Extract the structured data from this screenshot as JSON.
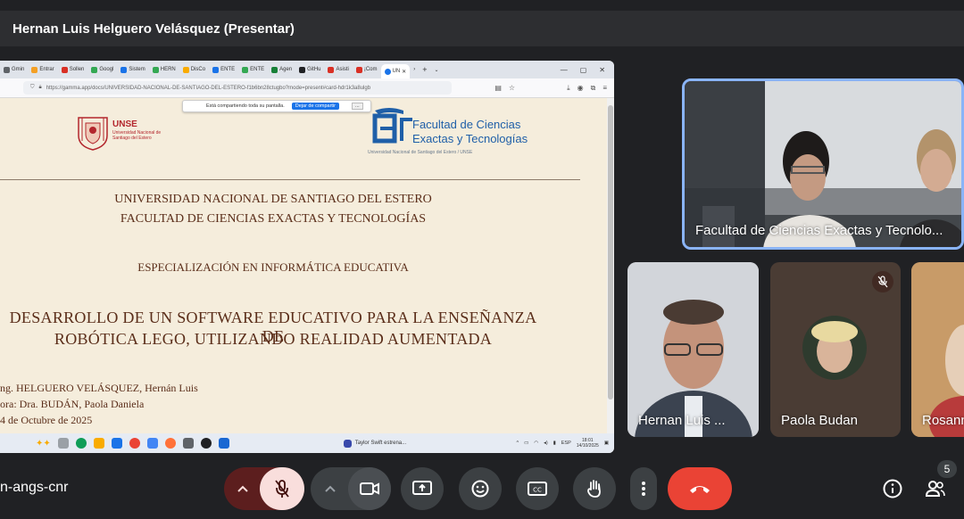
{
  "meeting": {
    "presenter_title": "Hernan Luis Helguero Velásquez (Presentar)",
    "meeting_code": "n-angs-cnr",
    "participant_count": "5"
  },
  "browser": {
    "tabs": [
      {
        "label": "Gmin",
        "color": "#5f6368"
      },
      {
        "label": "Entrar",
        "color": "#f4a025"
      },
      {
        "label": "Sollen",
        "color": "#d93025"
      },
      {
        "label": "Googl",
        "color": "#34a853"
      },
      {
        "label": "Sistem",
        "color": "#1a73e8"
      },
      {
        "label": "HERN",
        "color": "#34a853"
      },
      {
        "label": "DisCo",
        "color": "#f9ab00"
      },
      {
        "label": "ENTE",
        "color": "#1a73e8"
      },
      {
        "label": "ENTE",
        "color": "#34a853"
      },
      {
        "label": "Agen",
        "color": "#188038"
      },
      {
        "label": "GitHu",
        "color": "#202124"
      },
      {
        "label": "Asisti",
        "color": "#d93025"
      },
      {
        "label": "¡Com",
        "color": "#d93025"
      },
      {
        "label": "UN",
        "color": "#1a73e8"
      }
    ],
    "url": "https://gamma.app/docs/UNIVERSIDAD-NACIONAL-DE-SANTIAGO-DEL-ESTERO-f1b6bn28ctugbo?mode=present#card-hdr1k3a8ulgb",
    "share_notice": "Está compartiendo toda su pantalla.",
    "stop_share": "Dejar de compartir",
    "hide_label": "..."
  },
  "slide": {
    "unse_name": "UNSE",
    "unse_sub": "Universidad Nacional de Santiago del Estero",
    "fce_line1": "Facultad de Ciencias",
    "fce_line2": "Exactas y Tecnologías",
    "fce_sub": "Universidad Nacional de Santiago del Estero / UNSE",
    "university": "UNIVERSIDAD NACIONAL DE SANTIAGO DEL ESTERO",
    "faculty": "FACULTAD DE CIENCIAS EXACTAS Y TECNOLOGÍAS",
    "specialization": "ESPECIALIZACIÓN EN INFORMÁTICA EDUCATIVA",
    "title_line1": "DESARROLLO DE UN SOFTWARE EDUCATIVO PARA LA ENSEÑANZA DE",
    "title_line2": "ROBÓTICA LEGO, UTILIZANDO REALIDAD AUMENTADA",
    "author": "ng. HELGUERO VELÁSQUEZ, Hernán Luis",
    "director": "ora: Dra. BUDÁN, Paola Daniela",
    "date": "4 de Octubre de 2025"
  },
  "taskbar": {
    "news": "Taylor Swift estrena...",
    "lang": "ESP",
    "time": "18:01",
    "date": "14/10/2025"
  },
  "participants": {
    "room": "Facultad de Ciencias Exactas y Tecnolo...",
    "hernan": "Hernan Luis ...",
    "paola": "Paola Budan",
    "rosan": "Rosann"
  },
  "colors": {
    "hangup": "#ea4335",
    "mic_muted": "#f9dedc",
    "active_border": "#8ab4f8"
  }
}
